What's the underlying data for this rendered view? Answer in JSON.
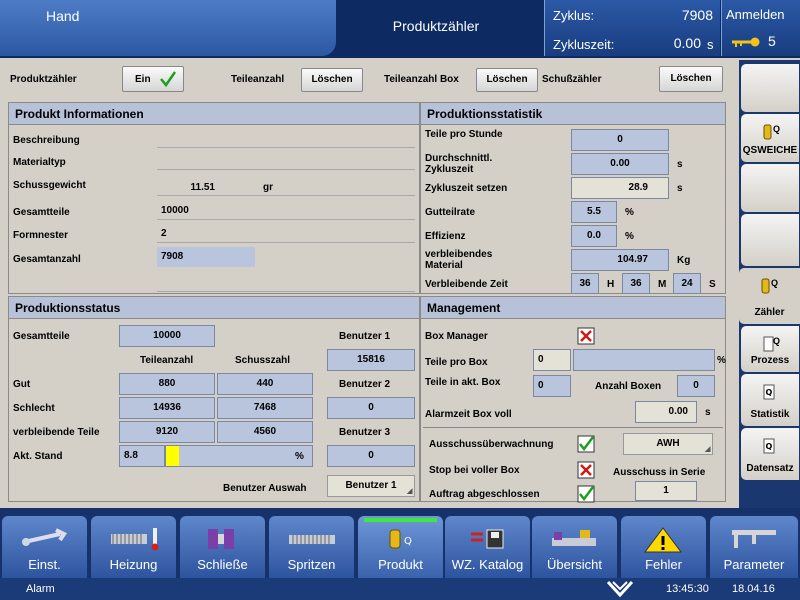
{
  "header": {
    "mode": "Hand",
    "title": "Produktzähler",
    "zyklus_label": "Zyklus:",
    "zyklus_value": "7908",
    "zykluszeit_label": "Zykluszeit:",
    "zykluszeit_value": "0.00",
    "zykluszeit_unit": "s",
    "login_label": "Anmelden",
    "login_level": "5"
  },
  "toolbar": {
    "produktzaehler_label": "Produktzähler",
    "ein_label": "Ein",
    "teileanzahl_label": "Teileanzahl",
    "loeschen1": "Löschen",
    "teileanzahl_box_label": "Teileanzahl Box",
    "loeschen2": "Löschen",
    "schusszaehler_label": "Schußzähler",
    "loeschen3": "Löschen"
  },
  "produkt_info": {
    "title": "Produkt Informationen",
    "beschreibung_label": "Beschreibung",
    "materialtyp_label": "Materialtyp",
    "schussgewicht_label": "Schussgewicht",
    "schussgewicht_value": "11.51",
    "schussgewicht_unit": "gr",
    "gesamtteile_label": "Gesamtteile",
    "gesamtteile_value": "10000",
    "formnester_label": "Formnester",
    "formnester_value": "2",
    "gesamtanzahl_label": "Gesamtanzahl",
    "gesamtanzahl_value": "7908"
  },
  "statistik": {
    "title": "Produktionsstatistik",
    "teile_pro_stunde_label": "Teile pro Stunde",
    "teile_pro_stunde_value": "0",
    "durchschn_label": "Durchschnittl. Zykluszeit",
    "durchschn_value": "0.00",
    "durchschn_unit": "s",
    "zyklus_setzen_label": "Zykluszeit setzen",
    "zyklus_setzen_value": "28.9",
    "zyklus_setzen_unit": "s",
    "gutteilrate_label": "Gutteilrate",
    "gutteilrate_value": "5.5",
    "gutteilrate_unit": "%",
    "effizienz_label": "Effizienz",
    "effizienz_value": "0.0",
    "effizienz_unit": "%",
    "verbl_material_label": "verbleibendes Material",
    "verbl_material_value": "104.97",
    "verbl_material_unit": "Kg",
    "verbl_zeit_label": "Verbleibende Zeit",
    "zeit_h": "36",
    "zeit_h_unit": "H",
    "zeit_m": "36",
    "zeit_m_unit": "M",
    "zeit_s": "24",
    "zeit_s_unit": "S"
  },
  "produktionsstatus": {
    "title": "Produktionsstatus",
    "gesamtteile_label": "Gesamtteile",
    "gesamtteile_value": "10000",
    "col_teileanzahl": "Teileanzahl",
    "col_schusszahl": "Schusszahl",
    "rows": [
      {
        "label": "Gut",
        "teile": "880",
        "schuss": "440"
      },
      {
        "label": "Schlecht",
        "teile": "14936",
        "schuss": "7468"
      },
      {
        "label": "verbleibende Teile",
        "teile": "9120",
        "schuss": "4560"
      }
    ],
    "akt_stand_label": "Akt. Stand",
    "akt_stand_value": "8.8",
    "akt_stand_unit": "%",
    "akt_stand_fraction": 0.088,
    "benutzer1_label": "Benutzer 1",
    "benutzer1_value": "15816",
    "benutzer2_label": "Benutzer 2",
    "benutzer2_value": "0",
    "benutzer3_label": "Benutzer 3",
    "benutzer3_value": "0",
    "benutzer_auswahl_label": "Benutzer Auswah",
    "benutzer_auswahl_value": "Benutzer 1"
  },
  "management": {
    "title": "Management",
    "box_manager_label": "Box Manager",
    "teile_pro_box_label": "Teile pro Box",
    "teile_pro_box_value": "0",
    "teile_pro_box_unit": "%",
    "teile_akt_box_label": "Teile in akt. Box",
    "teile_akt_box_value": "0",
    "anzahl_boxen_label": "Anzahl Boxen",
    "anzahl_boxen_value": "0",
    "alarmzeit_label": "Alarmzeit Box voll",
    "alarmzeit_value": "0.00",
    "alarmzeit_unit": "s",
    "ausschuss_label": "Ausschussüberwachnung",
    "awh_value": "AWH",
    "stop_label": "Stop bei voller Box",
    "ausschuss_serie_label": "Ausschuss in Serie",
    "auftrag_label": "Auftrag abgeschlossen",
    "auftrag_value": "1"
  },
  "right_nav": [
    {
      "label": "QSWEICHE"
    },
    {
      "label": "Zähler"
    },
    {
      "label": "Prozess"
    },
    {
      "label": "Statistik"
    },
    {
      "label": "Datensatz"
    }
  ],
  "bottom_nav": [
    {
      "label": "Einst."
    },
    {
      "label": "Heizung"
    },
    {
      "label": "Schließe"
    },
    {
      "label": "Spritzen"
    },
    {
      "label": "Produkt"
    },
    {
      "label": "WZ. Katalog"
    },
    {
      "label": "Übersicht"
    },
    {
      "label": "Fehler"
    },
    {
      "label": "Parameter"
    }
  ],
  "status_bar": {
    "alarm": "Alarm",
    "time": "13:45:30",
    "date": "18.04.16"
  },
  "colors": {
    "navy": "#0d2a63",
    "field_blue": "#b9c5dc",
    "check_green": "#1e9e1e",
    "cross_red": "#d01818",
    "progress_yellow": "#ffff00"
  }
}
